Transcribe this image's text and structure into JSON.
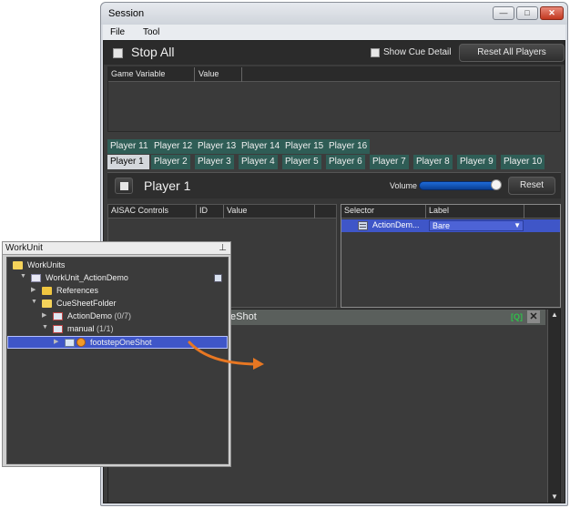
{
  "window": {
    "title": "Session",
    "minimize": "—",
    "maximize": "□",
    "close": "✕"
  },
  "menu": [
    "File",
    "Tool"
  ],
  "toolbar": {
    "stop_all": "Stop All",
    "show_cue_detail": "Show Cue Detail",
    "reset_all_players": "Reset All Players"
  },
  "game_variables": {
    "columns": [
      "Game Variable",
      "Value"
    ]
  },
  "player_tabs_row1": [
    "Player 11",
    "Player 12",
    "Player 13",
    "Player 14",
    "Player 15",
    "Player 16"
  ],
  "player_tabs_row2": [
    "Player 1",
    "Player 2",
    "Player 3",
    "Player 4",
    "Player 5",
    "Player 6",
    "Player 7",
    "Player 8",
    "Player 9",
    "Player 10"
  ],
  "active_tab": "Player 1",
  "player": {
    "title": "Player 1",
    "volume_label": "Volume",
    "volume": 0.9,
    "reset": "Reset"
  },
  "aisac": {
    "columns": [
      "AISAC Controls",
      "ID",
      "Value"
    ]
  },
  "selector": {
    "columns": [
      "Selector",
      "Label"
    ],
    "rows": [
      {
        "selector": "ActionDem...",
        "label": "Bare"
      }
    ]
  },
  "cue": {
    "title": "eShot",
    "q": "[Q]",
    "close": "✕"
  },
  "workunit": {
    "title": "WorkUnit",
    "pin": "⊥",
    "tree": {
      "root": "WorkUnits",
      "unit": "WorkUnit_ActionDemo",
      "references": "References",
      "folder": "CueSheetFolder",
      "cuesheet": "ActionDemo",
      "cuesheet_count": "(0/7)",
      "group": "manual",
      "group_count": "(1/1)",
      "cue": "footstepOneShot"
    }
  },
  "colors": {
    "selection": "#3f56c8",
    "tab_teal": "#2f5d56",
    "arrow": "#e87722"
  }
}
